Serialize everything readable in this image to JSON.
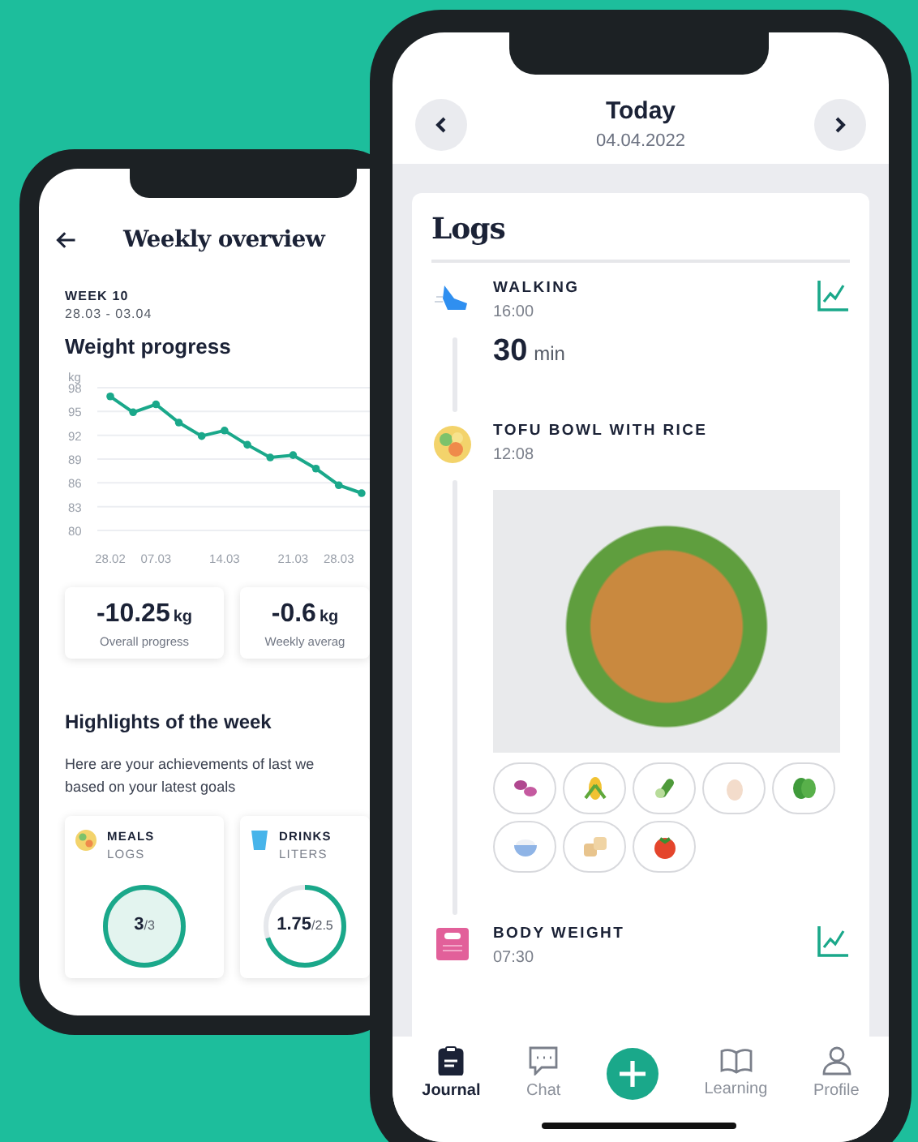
{
  "weekly_overview": {
    "title": "Weekly overview",
    "week_label": "WEEK 10",
    "week_range": "28.03 - 03.04",
    "chart_title": "Weight progress",
    "chart_data": {
      "type": "line",
      "ylabel": "kg",
      "categories": [
        "28.02",
        null,
        "07.03",
        null,
        null,
        "14.03",
        null,
        null,
        "21.03",
        null,
        "28.03",
        null
      ],
      "grid": true,
      "series": [
        {
          "color": "#1aa88a",
          "marker": true,
          "values": [
            96.9,
            94.9,
            95.9,
            93.6,
            91.9,
            92.6,
            90.8,
            89.2,
            89.5,
            87.8,
            85.7,
            84.7
          ]
        }
      ],
      "ylim": [
        80,
        98
      ],
      "yticks": [
        80,
        83,
        86,
        89,
        92,
        95,
        98
      ]
    },
    "stats": [
      {
        "value": "-10.25",
        "unit": "kg",
        "label": "Overall progress"
      },
      {
        "value": "-0.6",
        "unit": "kg",
        "label": "Weekly averag"
      }
    ],
    "highlights_title": "Highlights of the week",
    "highlights_text": "Here are your achievements of last we based on your latest goals",
    "highlights": [
      {
        "kind": "meals",
        "title": "MEALS",
        "subtitle": "LOGS",
        "value": "3",
        "goal": "/3",
        "level": 1
      },
      {
        "kind": "drinks",
        "title": "DRINKS",
        "subtitle": "LITERS",
        "value": "1.75",
        "goal": "/2.5",
        "level": 0.7
      }
    ]
  },
  "journal": {
    "title": "Today",
    "date": "04.04.2022",
    "logs_title": "Logs",
    "entries": [
      {
        "kind": "activity",
        "title": "WALKING",
        "time": "16:00",
        "value": "30",
        "unit": "min",
        "trend": true
      },
      {
        "kind": "meal",
        "title": "TOFU BOWL WITH RICE",
        "time": "12:08",
        "trend": false,
        "ingredients": [
          {
            "kind": "bean"
          },
          {
            "kind": "corn"
          },
          {
            "kind": "cucumber"
          },
          {
            "kind": "egg"
          },
          {
            "kind": "spinach"
          },
          {
            "kind": "rice"
          },
          {
            "kind": "tofu"
          },
          {
            "kind": "tomato"
          }
        ]
      },
      {
        "kind": "weight",
        "title": "BODY WEIGHT",
        "time": "07:30",
        "trend": true
      }
    ],
    "nav": [
      {
        "kind": "journal",
        "label": "Journal",
        "selected": true
      },
      {
        "kind": "chat",
        "label": "Chat",
        "selected": false
      },
      {
        "kind": "add",
        "selected": false
      },
      {
        "kind": "learning",
        "label": "Learning",
        "selected": false
      },
      {
        "kind": "profile",
        "label": "Profile",
        "selected": false
      }
    ]
  }
}
